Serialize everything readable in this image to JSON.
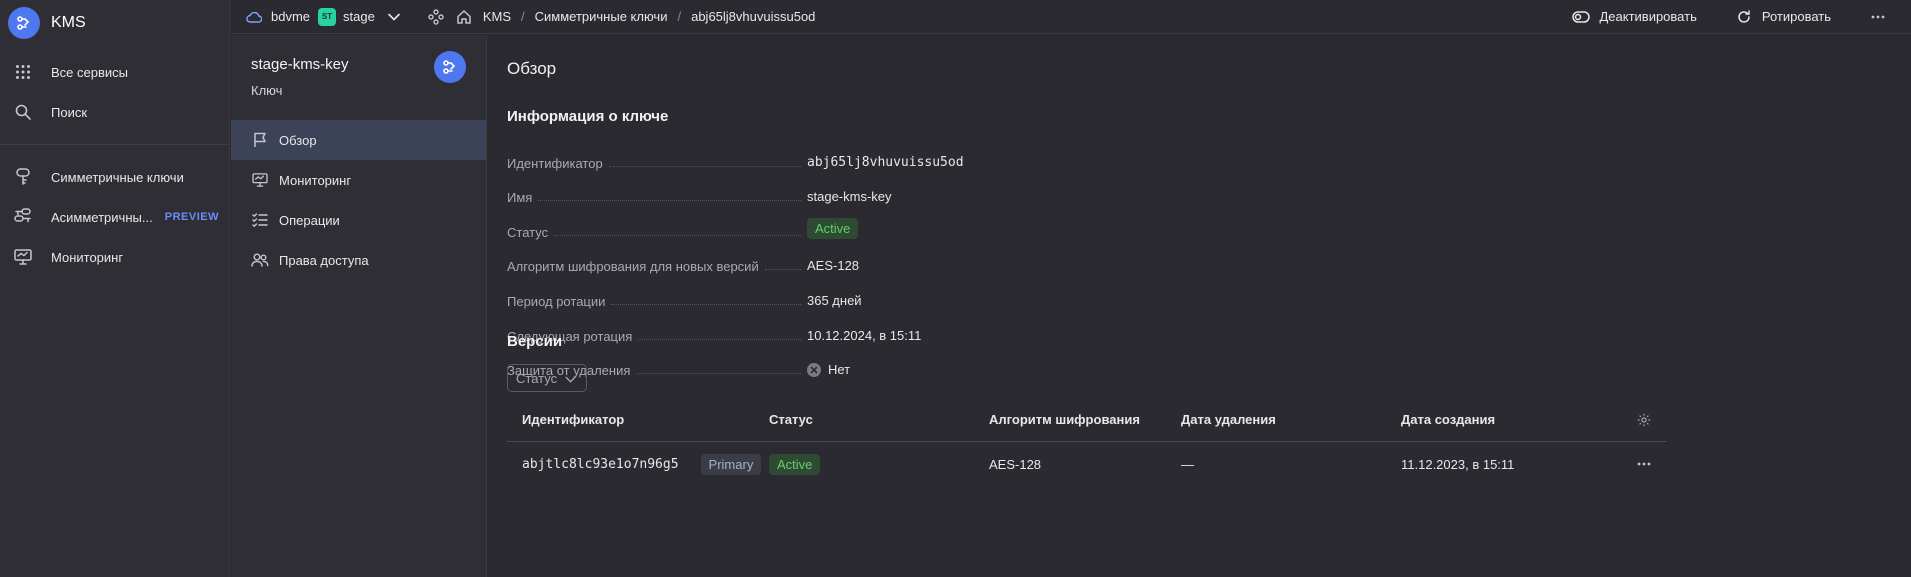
{
  "nav": {
    "logo": "KMS",
    "items": [
      {
        "label": "Все сервисы",
        "icon": "grid-icon"
      },
      {
        "label": "Поиск",
        "icon": "search-icon"
      }
    ],
    "service_items": [
      {
        "label": "Симметричные ключи",
        "icon": "key-icon"
      },
      {
        "label": "Асимметричны...",
        "icon": "asymmetric-key-icon",
        "badge": "PREVIEW"
      },
      {
        "label": "Мониторинг",
        "icon": "monitor-icon"
      }
    ]
  },
  "header": {
    "cloud": "bdvme",
    "env_badge": "ST",
    "folder": "stage",
    "breadcrumbs": [
      "KMS",
      "Симметричные ключи",
      "abj65lj8vhuvuissu5od"
    ],
    "actions": {
      "deactivate": "Деактивировать",
      "rotate": "Ротировать"
    }
  },
  "side": {
    "title": "stage-kms-key",
    "subtitle": "Ключ",
    "items": [
      {
        "label": "Обзор",
        "icon": "flag-icon",
        "active": true
      },
      {
        "label": "Мониторинг",
        "icon": "monitor-icon"
      },
      {
        "label": "Операции",
        "icon": "list-check-icon"
      },
      {
        "label": "Права доступа",
        "icon": "persons-icon"
      }
    ]
  },
  "main": {
    "title": "Обзор",
    "info_title": "Информация о ключе",
    "props": [
      {
        "key": "Идентификатор",
        "value": "abj65lj8vhuvuissu5od"
      },
      {
        "key": "Имя",
        "value": "stage-kms-key"
      },
      {
        "key": "Статус",
        "value": "Active"
      },
      {
        "key": "Алгоритм шифрования для новых версий",
        "value": "AES-128"
      },
      {
        "key": "Период ротации",
        "value": "365 дней"
      },
      {
        "key": "Следующая ротация",
        "value": "10.12.2024, в 15:11"
      },
      {
        "key": "Защита от удаления",
        "value": "Нет"
      }
    ],
    "versions_title": "Версии",
    "filter_label": "Статус",
    "table": {
      "headers": [
        "Идентификатор",
        "Статус",
        "Алгоритм шифрования",
        "Дата удаления",
        "Дата создания"
      ],
      "rows": [
        {
          "id": "abjtlc8lc93e1o7n96g5",
          "badge": "Primary",
          "status": "Active",
          "algorithm": "AES-128",
          "deleted": "—",
          "created": "11.12.2023, в 15:11"
        }
      ]
    }
  },
  "colors": {
    "accent": "#4e78f0",
    "active_status": "#5fd16c",
    "preview": "#6b8cff"
  }
}
